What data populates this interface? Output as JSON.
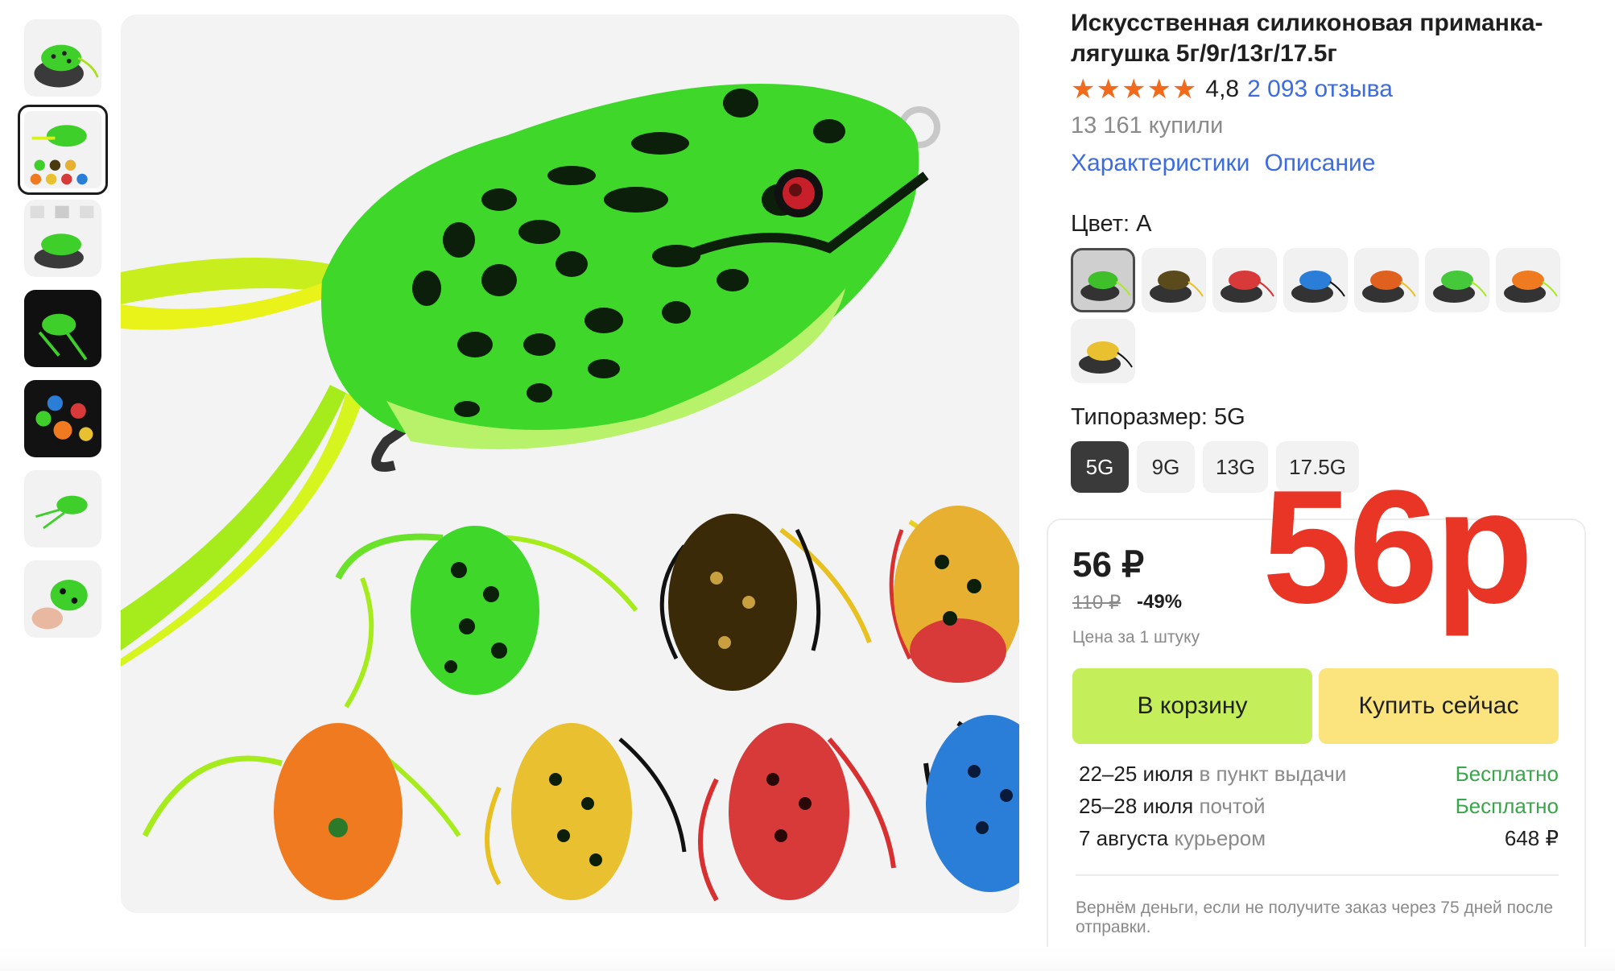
{
  "product": {
    "title": "Искусственная силиконовая приманка-лягушка 5г/9г/13г/17.5г",
    "stars": "★★★★★",
    "rating": "4,8",
    "reviews": "2 093 отзыва",
    "bought": "13 161 купили"
  },
  "tabs": {
    "characteristics": "Характеристики",
    "description": "Описание"
  },
  "color": {
    "label": "Цвет: A",
    "swatch_colors": [
      "#3fbf2a",
      "#5a4a1c",
      "#d83a3a",
      "#2a7ed8",
      "#e06020",
      "#45c83a",
      "#f07a20",
      "#e8c030"
    ]
  },
  "size": {
    "label": "Типоразмер: 5G",
    "options": [
      "5G",
      "9G",
      "13G",
      "17.5G"
    ]
  },
  "price": {
    "current": "56 ₽",
    "old": "110 ₽",
    "discount": "-49%",
    "unit_note": "Цена за 1 штуку",
    "overlay": "56р"
  },
  "buttons": {
    "cart": "В корзину",
    "buy": "Купить сейчас"
  },
  "delivery": [
    {
      "date": "22–25 июля",
      "method": "в пункт выдачи",
      "cost": "Бесплатно"
    },
    {
      "date": "25–28 июля",
      "method": "почтой",
      "cost": "Бесплатно"
    },
    {
      "date": "7 августа",
      "method": "курьером",
      "cost": "648 ₽"
    }
  ],
  "refund_note": "Вернём деньги, если не получите заказ через 75 дней после отправки."
}
